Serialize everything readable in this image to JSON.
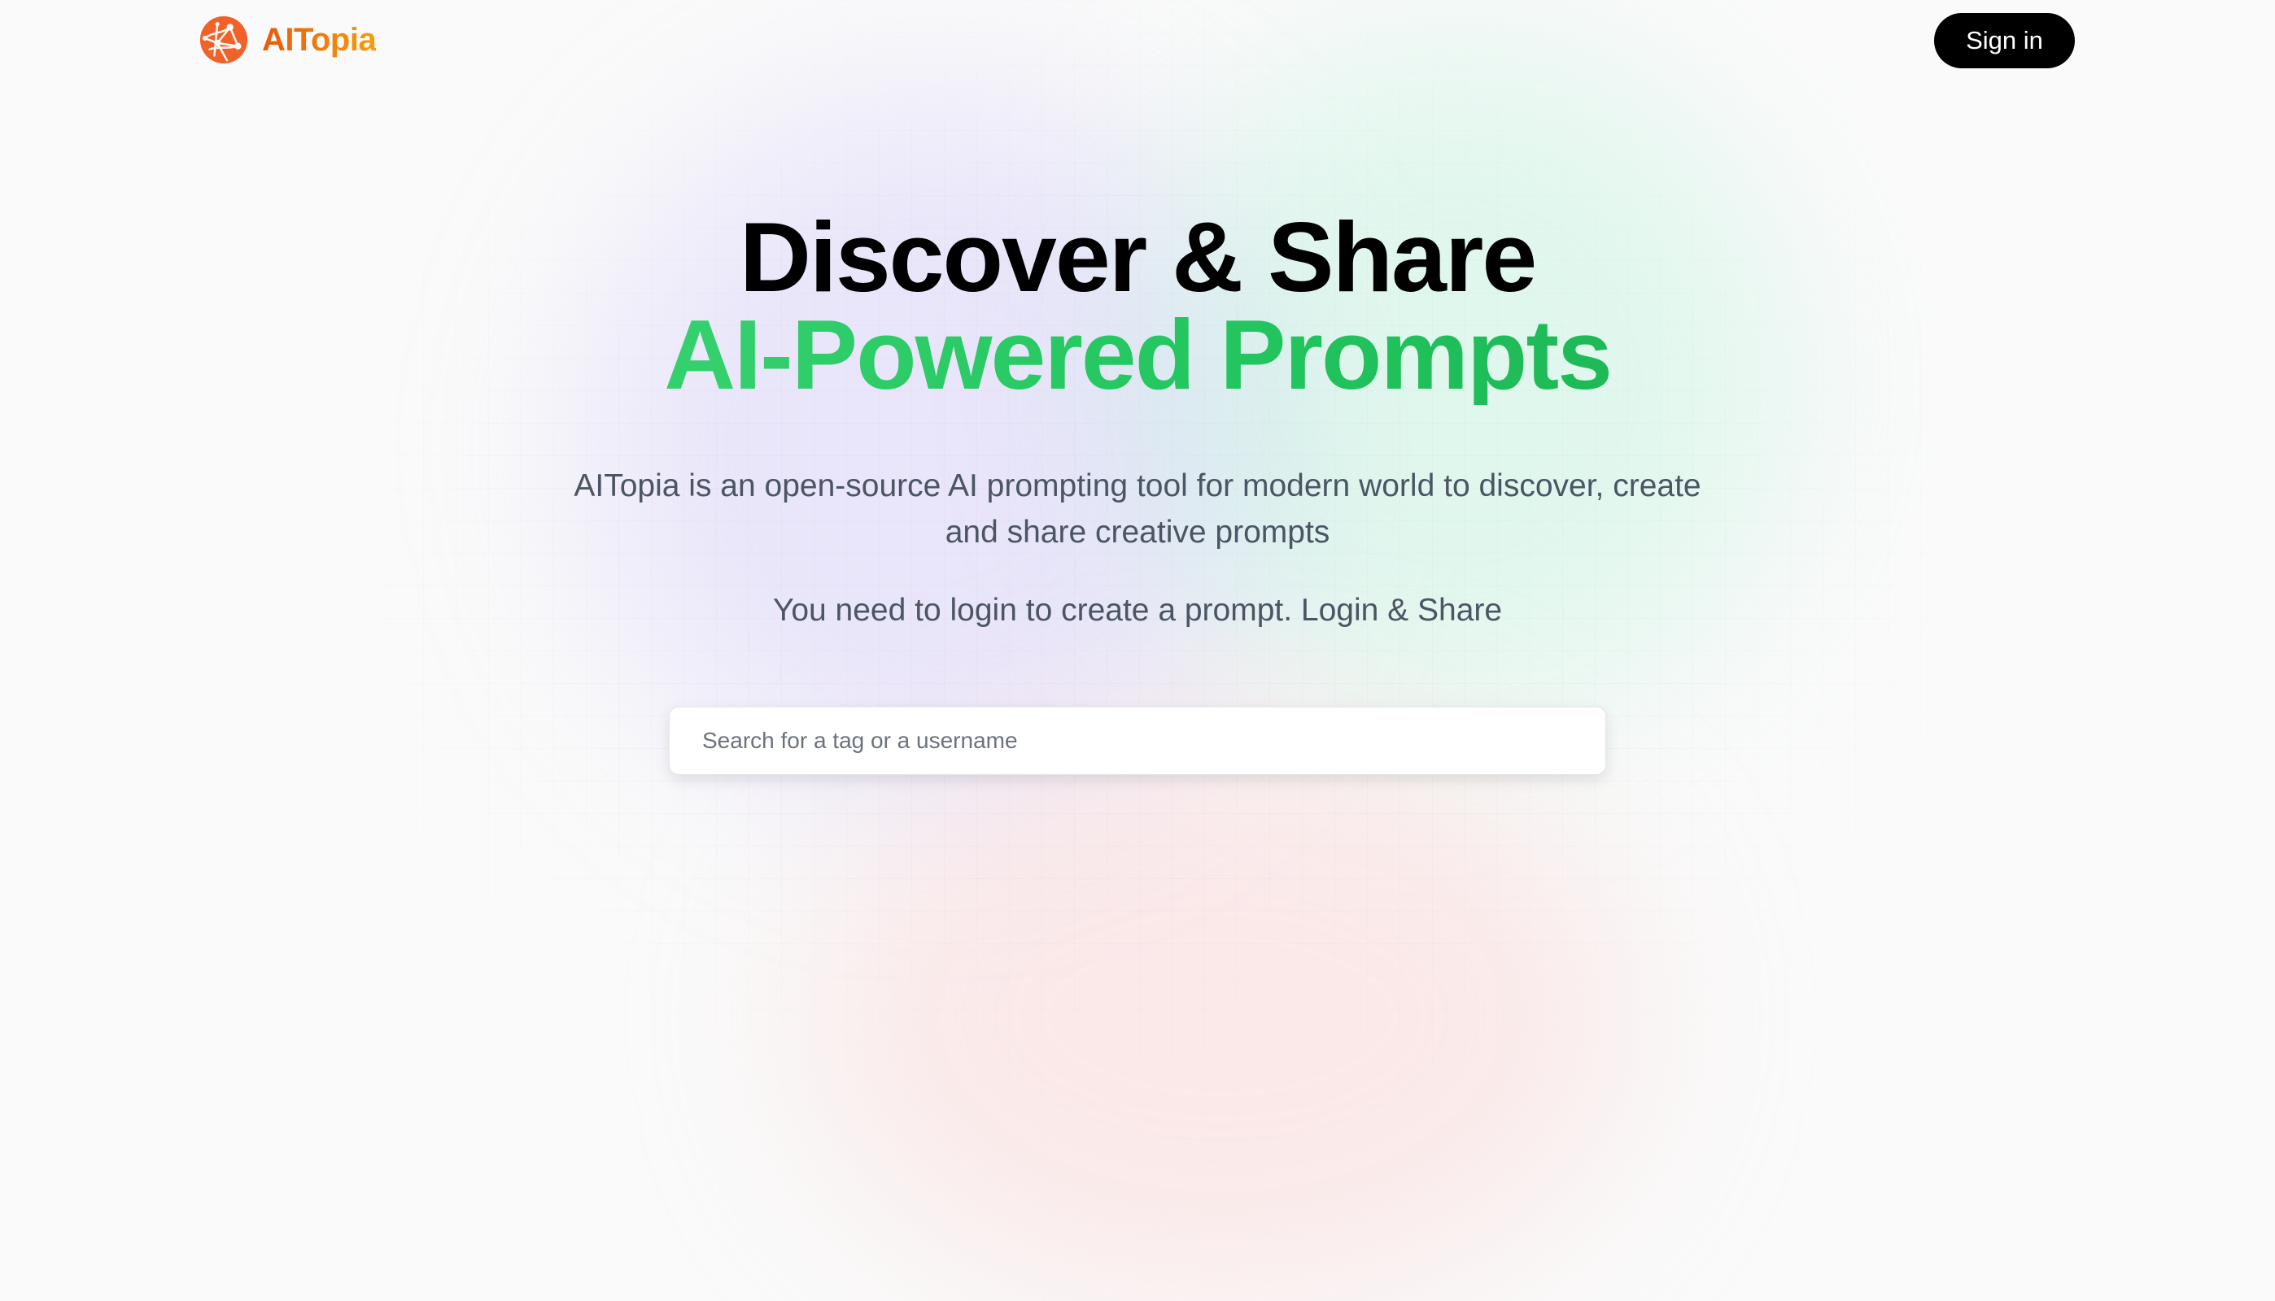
{
  "brand": {
    "name": "AITopia",
    "logo_icon": "globe-network-icon",
    "color_from": "#ea580c",
    "color_to": "#f59e0b"
  },
  "nav": {
    "signin_label": "Sign in"
  },
  "hero": {
    "title_line1": "Discover & Share",
    "title_line2": "AI-Powered Prompts",
    "accent_color": "#22c55e",
    "description": "AITopia is an open-source AI prompting tool for modern world to discover, create and share creative prompts",
    "login_note": "You need to login to create a prompt. Login & Share"
  },
  "search": {
    "placeholder": "Search for a tag or a username",
    "value": ""
  }
}
